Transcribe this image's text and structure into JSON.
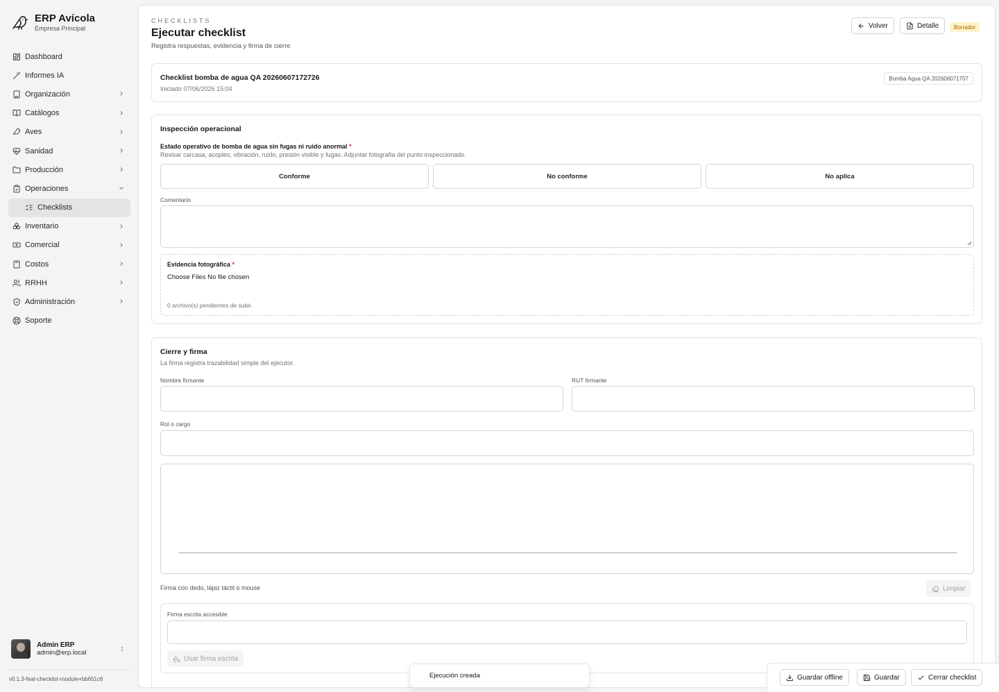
{
  "app": {
    "title": "ERP Avícola",
    "company": "Empresa Principal"
  },
  "nav": [
    {
      "label": "Dashboard",
      "icon": "grid-icon"
    },
    {
      "label": "Informes IA",
      "icon": "wand-icon"
    },
    {
      "label": "Organización",
      "icon": "building-icon"
    },
    {
      "label": "Catálogos",
      "icon": "book-icon"
    },
    {
      "label": "Aves",
      "icon": "bird-icon"
    },
    {
      "label": "Sanidad",
      "icon": "heart-pulse-icon"
    },
    {
      "label": "Producción",
      "icon": "folder-icon"
    },
    {
      "label": "Operaciones",
      "icon": "clipboard-icon"
    },
    {
      "label": "Checklists",
      "icon": "list-checks-icon"
    },
    {
      "label": "Inventario",
      "icon": "boxes-icon"
    },
    {
      "label": "Comercial",
      "icon": "banknote-icon"
    },
    {
      "label": "Costos",
      "icon": "calculator-icon"
    },
    {
      "label": "RRHH",
      "icon": "users-icon"
    },
    {
      "label": "Administración",
      "icon": "shield-icon"
    },
    {
      "label": "Soporte",
      "icon": "lifebuoy-icon"
    }
  ],
  "user": {
    "name": "Admin ERP",
    "email": "admin@erp.local"
  },
  "version": "v0.1.3-feat-checklist-module+bb651c6",
  "header": {
    "eyebrow": "CHECKLISTS",
    "title": "Ejecutar checklist",
    "subtitle": "Registra respuestas, evidencia y firma de cierre",
    "back_label": "Volver",
    "detail_label": "Detalle",
    "status": "Borrador"
  },
  "summary": {
    "title": "Checklist bomba de agua QA 20260607172726",
    "started": "Iniciado 07/06/2026 15:04",
    "tag": "Bomba Agua QA 202606071707"
  },
  "inspection": {
    "title": "Inspección operacional",
    "question": "Estado operativo de bomba de agua sin fugas ni ruido anormal",
    "required_mark": "*",
    "hint": "Revisar carcasa, acoples, vibración, ruido, presión visible y fugas. Adjuntar fotografía del punto inspeccionado.",
    "options": [
      "Conforme",
      "No conforme",
      "No aplica"
    ],
    "comment_label": "Comentario",
    "evidence_label": "Evidencia fotográfica",
    "file_button": "Choose Files",
    "file_status": "No file chosen",
    "pending": "0 archivo(s) pendientes de subir."
  },
  "signature": {
    "title": "Cierre y firma",
    "subtitle": "La firma registra trazabilidad simple del ejecutor.",
    "name_label": "Nombre firmante",
    "rut_label": "RUT firmante",
    "role_label": "Rol o cargo",
    "pad_hint": "Firma con dedo, lápiz táctil o mouse",
    "clear_label": "Limpiar",
    "written_label": "Firma escrita accesible",
    "use_written_label": "Usar firma escrita"
  },
  "footer": {
    "offline_label": "Guardar offline",
    "save_label": "Guardar",
    "close_label": "Cerrar checklist"
  },
  "toast": "Ejecución creada",
  "colors": {
    "status_bg": "#fef3c7",
    "status_text": "#a16207",
    "required": "#dc2626"
  }
}
